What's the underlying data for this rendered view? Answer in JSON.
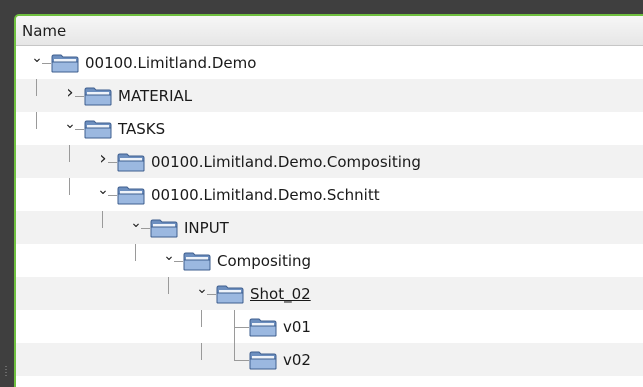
{
  "tree": {
    "header": "Name",
    "nodes": [
      {
        "label": "00100.Limitland.Demo",
        "depth": 0,
        "expander": "expanded"
      },
      {
        "label": "MATERIAL",
        "depth": 1,
        "expander": "collapsed"
      },
      {
        "label": "TASKS",
        "depth": 1,
        "expander": "expanded"
      },
      {
        "label": "00100.Limitland.Demo.Compositing",
        "depth": 2,
        "expander": "collapsed"
      },
      {
        "label": "00100.Limitland.Demo.Schnitt",
        "depth": 2,
        "expander": "expanded"
      },
      {
        "label": "INPUT",
        "depth": 3,
        "expander": "expanded"
      },
      {
        "label": "Compositing",
        "depth": 4,
        "expander": "expanded"
      },
      {
        "label": "Shot_02",
        "depth": 5,
        "expander": "expanded",
        "selected": true
      },
      {
        "label": "v01",
        "depth": 6,
        "expander": "none"
      },
      {
        "label": "v02",
        "depth": 6,
        "expander": "none"
      }
    ]
  },
  "colors": {
    "panel_border": "#6fbf3f",
    "folder_body": "#6d8fbf",
    "folder_front": "#9bb8e0"
  },
  "icons": {
    "folder": "folder-icon",
    "expanded": "chevron-down-icon",
    "collapsed": "chevron-right-icon"
  }
}
